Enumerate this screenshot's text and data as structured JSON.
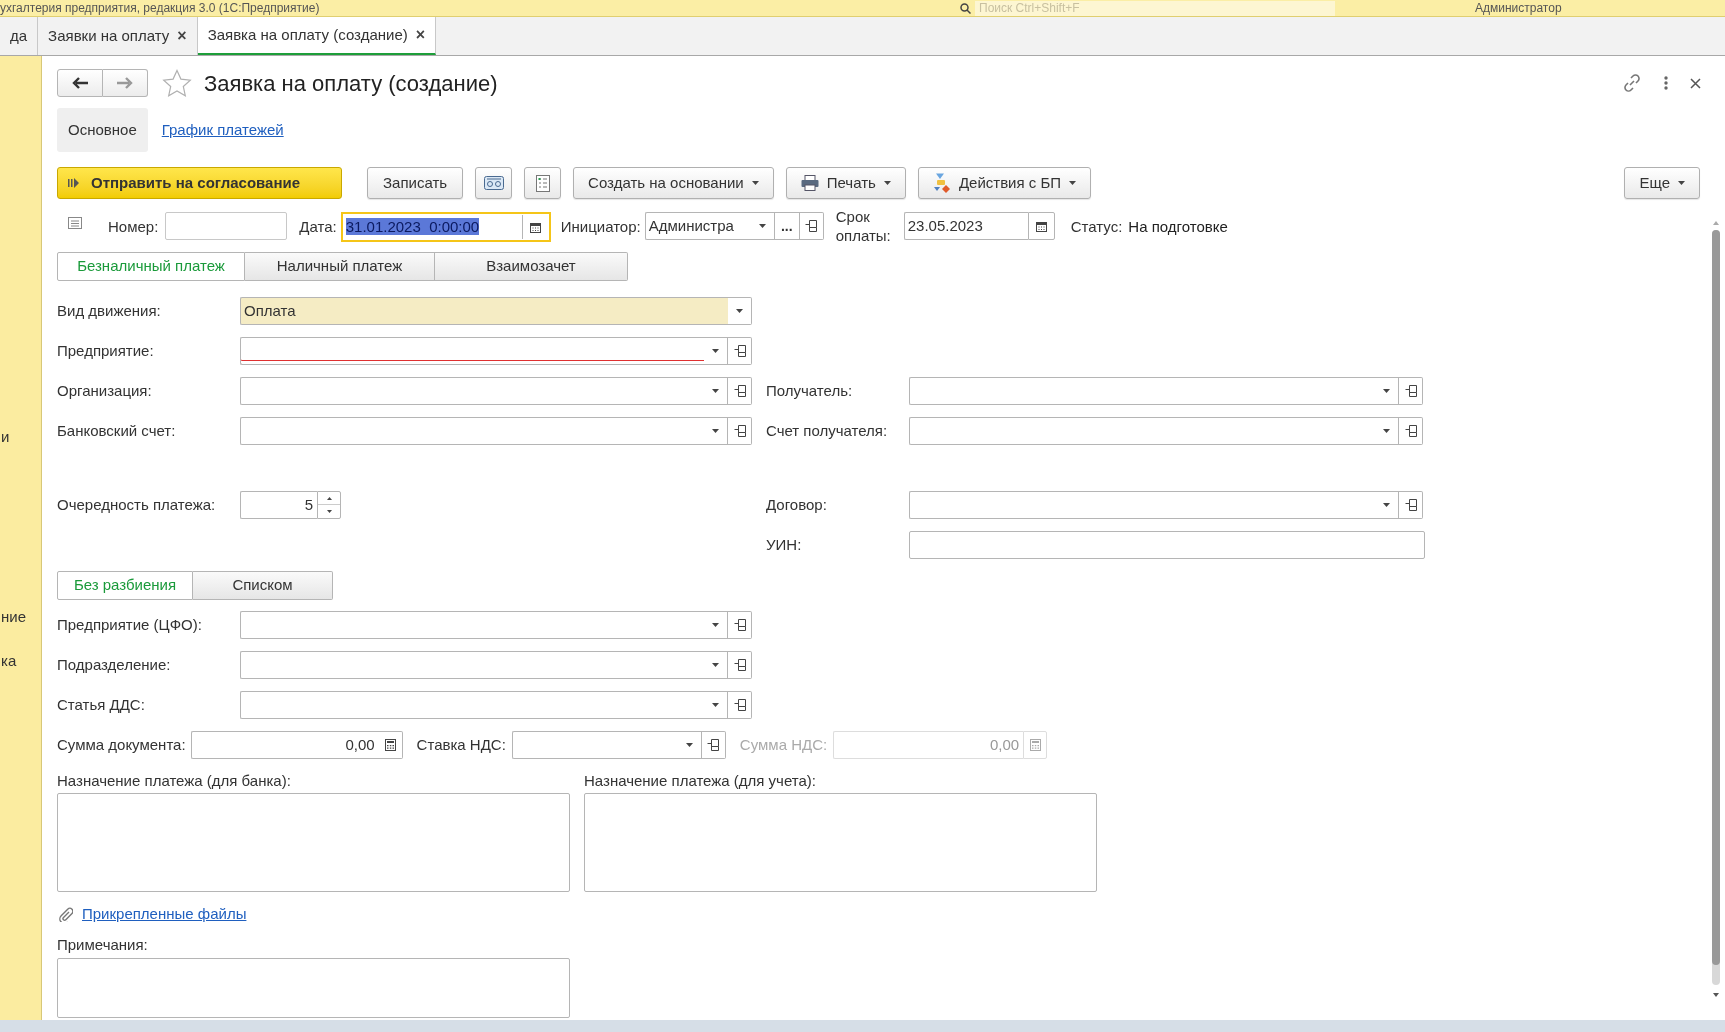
{
  "app_title": "ухгалтерия предприятия, редакция 3.0 (1С:Предприятие)",
  "search": {
    "placeholder": "Поиск Ctrl+Shift+F"
  },
  "user": "Администратор",
  "sidebar_fragments": [
    "и",
    "ние",
    "ка"
  ],
  "tabs": [
    {
      "label": "да",
      "selected": false
    },
    {
      "label": "Заявки на оплату",
      "close": "×",
      "selected": false
    },
    {
      "label": "Заявка на оплату (создание)",
      "close": "×",
      "selected": true
    }
  ],
  "form": {
    "title": "Заявка на оплату (создание)",
    "favorite": false,
    "sections": [
      {
        "label": "Основное",
        "selected": true
      },
      {
        "label": "График платежей",
        "selected": false
      }
    ],
    "toolbar": [
      {
        "kind": "primary",
        "label": "Отправить на согласование"
      },
      {
        "kind": "button",
        "label": "Записать"
      },
      {
        "kind": "menu",
        "label": "Создать на основании"
      },
      {
        "kind": "print",
        "label": "Печать"
      },
      {
        "kind": "process",
        "label": "Действия с БП"
      },
      {
        "kind": "more",
        "label": "Еще"
      }
    ],
    "header": {
      "number": {
        "label": "Номер:"
      },
      "date": {
        "label": "Дата:",
        "value": "31.01.2023  0:00:00",
        "focused": true,
        "text_selected": true
      },
      "initiator": {
        "label": "Инициатор:",
        "value": "Администра",
        "choose": "..."
      },
      "due": {
        "label": "Срок оплаты:",
        "value": "23.05.2023"
      },
      "status": {
        "label": "Статус:",
        "value": "На подготовке"
      }
    },
    "payment_types": [
      {
        "label": "Безналичный платеж",
        "selected": true
      },
      {
        "label": "Наличный платеж",
        "selected": false
      },
      {
        "label": "Взаимозачет",
        "selected": false
      }
    ],
    "left_groups": [
      [
        {
          "kind": "combo",
          "label": "Вид движения:",
          "value": "Оплата",
          "highlighted": true,
          "required": false
        },
        {
          "kind": "select",
          "label": "Предприятие:",
          "highlighted": false,
          "required": true
        },
        {
          "kind": "select",
          "label": "Организация:",
          "highlighted": false,
          "required": false
        },
        {
          "kind": "select",
          "label": "Банковский счет:",
          "highlighted": false,
          "required": false
        }
      ],
      [
        {
          "kind": "spin",
          "label": "Очередность платежа:",
          "value": "5",
          "highlighted": false,
          "required": false
        }
      ]
    ],
    "right_groups": [
      [
        {
          "kind": "select",
          "label": "Получатель:",
          "highlighted": false,
          "required": false
        },
        {
          "kind": "select",
          "label": "Счет получателя:",
          "highlighted": false,
          "required": false
        }
      ],
      [
        {
          "kind": "select",
          "label": "Договор:",
          "highlighted": false,
          "required": false
        },
        {
          "kind": "text",
          "label": "УИН:",
          "highlighted": false,
          "required": false
        }
      ]
    ],
    "split_modes": [
      {
        "label": "Без разбиения",
        "selected": true
      },
      {
        "label": "Списком",
        "selected": false
      }
    ],
    "analytics": [
      {
        "label": "Предприятие (ЦФО):",
        "highlighted": false,
        "required": false
      },
      {
        "label": "Подразделение:",
        "highlighted": false,
        "required": false
      },
      {
        "label": "Статья ДДС:",
        "highlighted": false,
        "required": false
      }
    ],
    "amounts": {
      "document_sum": {
        "label": "Сумма документа:",
        "value": "0,00"
      },
      "vat_rate": {
        "label": "Ставка НДС:"
      },
      "vat_sum": {
        "label": "Сумма НДС:",
        "value": "0,00",
        "disabled": true
      }
    },
    "purpose_bank": {
      "label": "Назначение платежа (для банка):"
    },
    "purpose_accounting": {
      "label": "Назначение платежа (для учета):"
    },
    "attachments_link": "Прикрепленные файлы",
    "notes": {
      "label": "Примечания:"
    }
  }
}
